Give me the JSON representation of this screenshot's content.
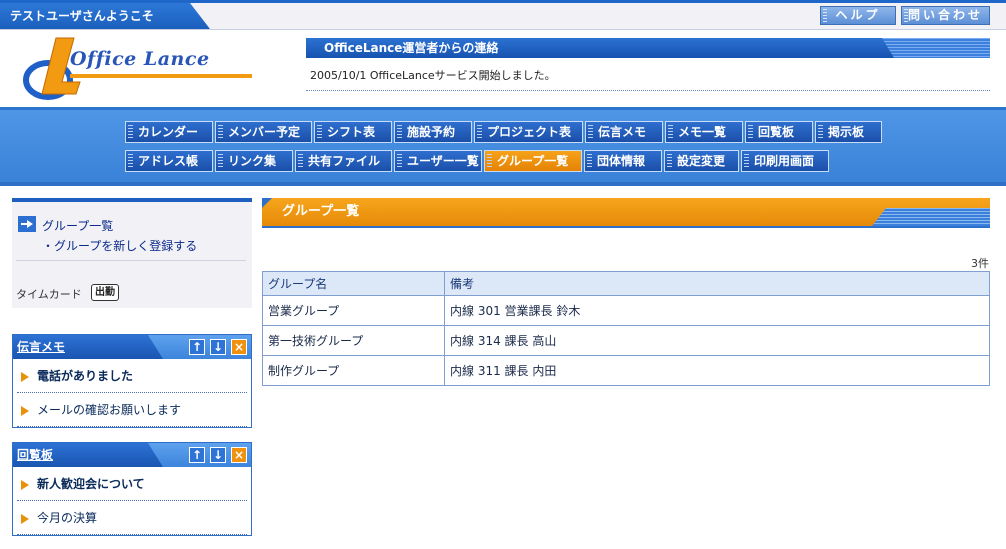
{
  "topbar": {
    "welcome": "テストユーザさんようこそ",
    "help_label": "ヘルプ",
    "contact_label": "問い合わせ"
  },
  "header": {
    "logo_text": "Office Lance",
    "notice_title": "OfficeLance運営者からの連絡",
    "notice_message": "2005/10/1 OfficeLanceサービス開始しました。"
  },
  "nav": {
    "row1": [
      "カレンダー",
      "メンバー予定",
      "シフト表",
      "施設予約",
      "プロジェクト表",
      "伝言メモ",
      "メモ一覧",
      "回覧板",
      "掲示板"
    ],
    "row2": [
      "アドレス帳",
      "リンク集",
      "共有ファイル",
      "ユーザー一覧",
      "グループ一覧",
      "団体情報",
      "設定変更",
      "印刷用画面"
    ],
    "active": "グループ一覧"
  },
  "sidebar": {
    "link_main": "グループ一覧",
    "link_sub": "・グループを新しく登録する",
    "timecard_label": "タイムカード",
    "punch_label": "出勤"
  },
  "memo_widget": {
    "title": "伝言メモ",
    "items": [
      "電話がありました",
      "メールの確認お願いします"
    ]
  },
  "circular_widget": {
    "title": "回覧板",
    "items": [
      "新人歓迎会について",
      "今月の決算"
    ]
  },
  "main": {
    "title": "グループ一覧",
    "count": "3件",
    "columns": [
      "グループ名",
      "備考"
    ],
    "rows": [
      [
        "営業グループ",
        "内線 301 営業課長 鈴木"
      ],
      [
        "第一技術グループ",
        "内線 314 課長 高山"
      ],
      [
        "制作グループ",
        "内線 311 課長 内田"
      ]
    ]
  },
  "icons": {
    "up": "arrow-up-icon",
    "down": "arrow-down-icon",
    "close": "close-icon"
  },
  "colors": {
    "primary": "#1e5fbf",
    "accent": "#f39a12"
  }
}
